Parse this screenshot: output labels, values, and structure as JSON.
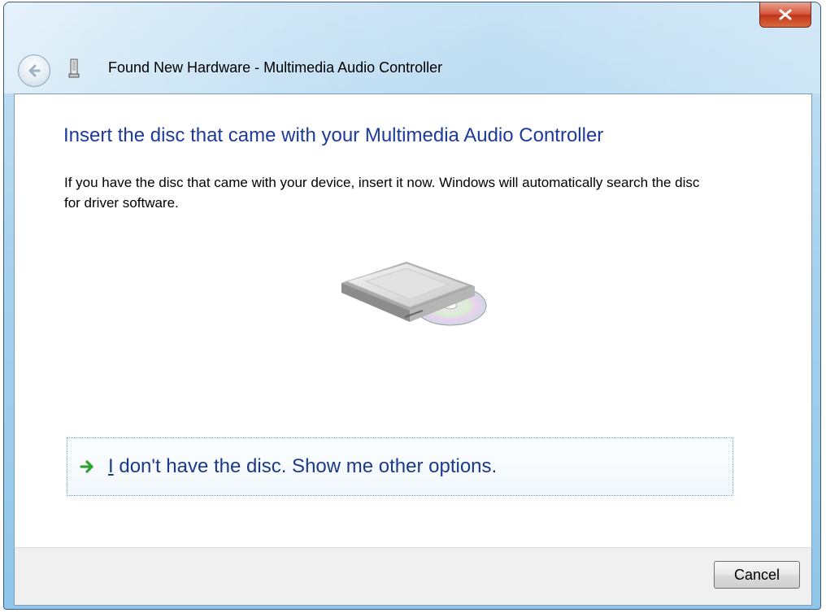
{
  "window": {
    "title": "Found New Hardware - Multimedia Audio Controller",
    "close_icon": "close-icon",
    "back_icon": "back-arrow-icon",
    "hardware_icon": "hardware-device-icon",
    "accent_color": "#1e3a9a",
    "close_color": "#c7442a"
  },
  "main": {
    "heading": "Insert the disc that came with your Multimedia Audio Controller",
    "description": "If you have the disc that came with your device, insert it now.  Windows will automatically search the disc for driver software.",
    "illustration_icon": "disc-drive-icon",
    "option": {
      "icon": "green-arrow-icon",
      "label_first": "I",
      "label_rest": " don't have the disc.  Show me other options."
    }
  },
  "footer": {
    "cancel_label": "Cancel"
  }
}
